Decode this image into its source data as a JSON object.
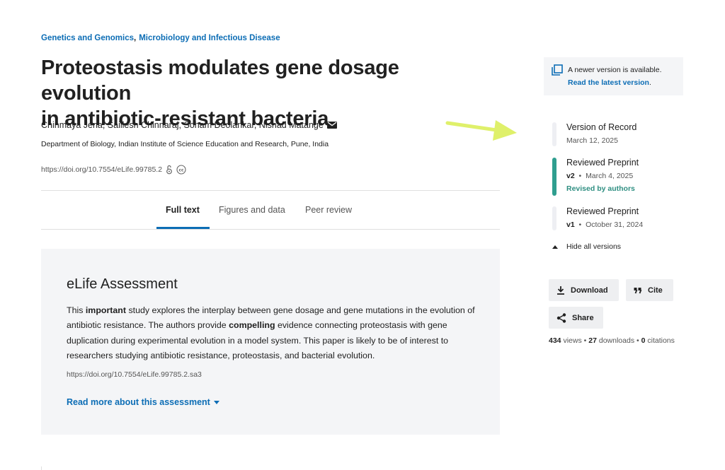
{
  "subjects": [
    "Genetics and Genomics",
    "Microbiology and Infectious Disease"
  ],
  "subject_separator": ",",
  "title_line1": "Proteostasis modulates gene dosage evolution",
  "title_line2": "in antibiotic-resistant bacteria",
  "authors": "Chinmaya Jena, Saillesh Chinnaraj, Soham Deolankar, Nishad Matange",
  "affiliation": "Department of Biology, Indian Institute of Science Education and Research, Pune, India",
  "doi": "https://doi.org/10.7554/eLife.99785.2",
  "tabs": [
    {
      "label": "Full text",
      "active": true
    },
    {
      "label": "Figures and data",
      "active": false
    },
    {
      "label": "Peer review",
      "active": false
    }
  ],
  "assessment": {
    "heading": "eLife Assessment",
    "p1": "This ",
    "b1": "important",
    "p2": " study explores the interplay between gene dosage and gene mutations in the evolution of antibiotic resistance. The authors provide ",
    "b2": "compelling",
    "p3": " evidence connecting proteostasis with gene duplication during experimental evolution in a model system. This paper is likely to be of interest to researchers studying antibiotic resistance, proteostasis, and bacterial evolution.",
    "doi": "https://doi.org/10.7554/eLife.99785.2.sa3",
    "read_more": "Read more about this assessment"
  },
  "notice": {
    "text": "A newer version is available.",
    "link": "Read the latest version",
    "link_suffix": "."
  },
  "versions": [
    {
      "title": "Version of Record",
      "version": "",
      "date": "March 12, 2025",
      "note": "",
      "active": false
    },
    {
      "title": "Reviewed Preprint",
      "version": "v2",
      "date": "March 4, 2025",
      "note": "Revised by authors",
      "active": true
    },
    {
      "title": "Reviewed Preprint",
      "version": "v1",
      "date": "October 31, 2024",
      "note": "",
      "active": false
    }
  ],
  "meta_separator": "•",
  "hide_versions": "Hide all versions",
  "actions": {
    "download": "Download",
    "cite": "Cite",
    "share": "Share"
  },
  "stats": {
    "views": "434",
    "views_label": "views",
    "downloads": "27",
    "downloads_label": "downloads",
    "citations": "0",
    "citations_label": "citations",
    "separator": "•"
  },
  "colors": {
    "link": "#0c6db5",
    "accent_teal": "#2f9e8f",
    "panel_bg": "#f4f5f7",
    "arrow": "#dff06a"
  },
  "icons": {
    "mail": "envelope-icon",
    "open_access": "open-access-icon",
    "cc": "creative-commons-icon",
    "newer": "copy-versions-icon",
    "download": "download-icon",
    "cite": "quote-icon",
    "share": "share-icon"
  }
}
